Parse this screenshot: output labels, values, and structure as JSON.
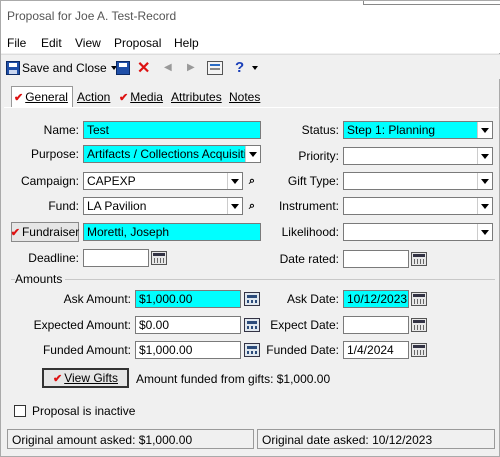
{
  "window": {
    "title": "Proposal for Joe A. Test-Record"
  },
  "menu": [
    "File",
    "Edit",
    "View",
    "Proposal",
    "Help"
  ],
  "toolbar": {
    "save_close": "Save and Close",
    "help": "?"
  },
  "tabs": [
    "General",
    "Action",
    "Media",
    "Attributes",
    "Notes"
  ],
  "left": {
    "name_label": "Name:",
    "name": "Test",
    "purpose_label": "Purpose:",
    "purpose": "Artifacts / Collections Acquisition",
    "campaign_label": "Campaign:",
    "campaign": "CAPEXP",
    "fund_label": "Fund:",
    "fund": "LA Pavilion",
    "fundraiser_button": "Fundraiser",
    "fundraiser": "Moretti, Joseph",
    "deadline_label": "Deadline:",
    "deadline": ""
  },
  "right": {
    "status_label": "Status:",
    "status": "Step 1: Planning",
    "priority_label": "Priority:",
    "priority": "",
    "gift_type_label": "Gift Type:",
    "gift_type": "",
    "instrument_label": "Instrument:",
    "instrument": "",
    "likelihood_label": "Likelihood:",
    "likelihood": "",
    "date_rated_label": "Date rated:",
    "date_rated": ""
  },
  "amounts": {
    "group_label": "Amounts",
    "ask_amount_label": "Ask Amount:",
    "ask_amount": "$1,000.00",
    "expected_amount_label": "Expected Amount:",
    "expected_amount": "$0.00",
    "funded_amount_label": "Funded Amount:",
    "funded_amount": "$1,000.00",
    "ask_date_label": "Ask Date:",
    "ask_date": "10/12/2023",
    "expect_date_label": "Expect Date:",
    "expect_date": "",
    "funded_date_label": "Funded Date:",
    "funded_date": "1/4/2024",
    "view_gifts_button": "View Gifts",
    "funded_from_gifts": "Amount funded from gifts: $1,000.00"
  },
  "inactive_label": "Proposal is inactive",
  "statusbar": {
    "original_amount": "Original amount asked: $1,000.00",
    "original_date": "Original date asked: 10/12/2023"
  },
  "colors": {
    "required_field": "#00ffff",
    "check_mark": "#dd1111"
  }
}
